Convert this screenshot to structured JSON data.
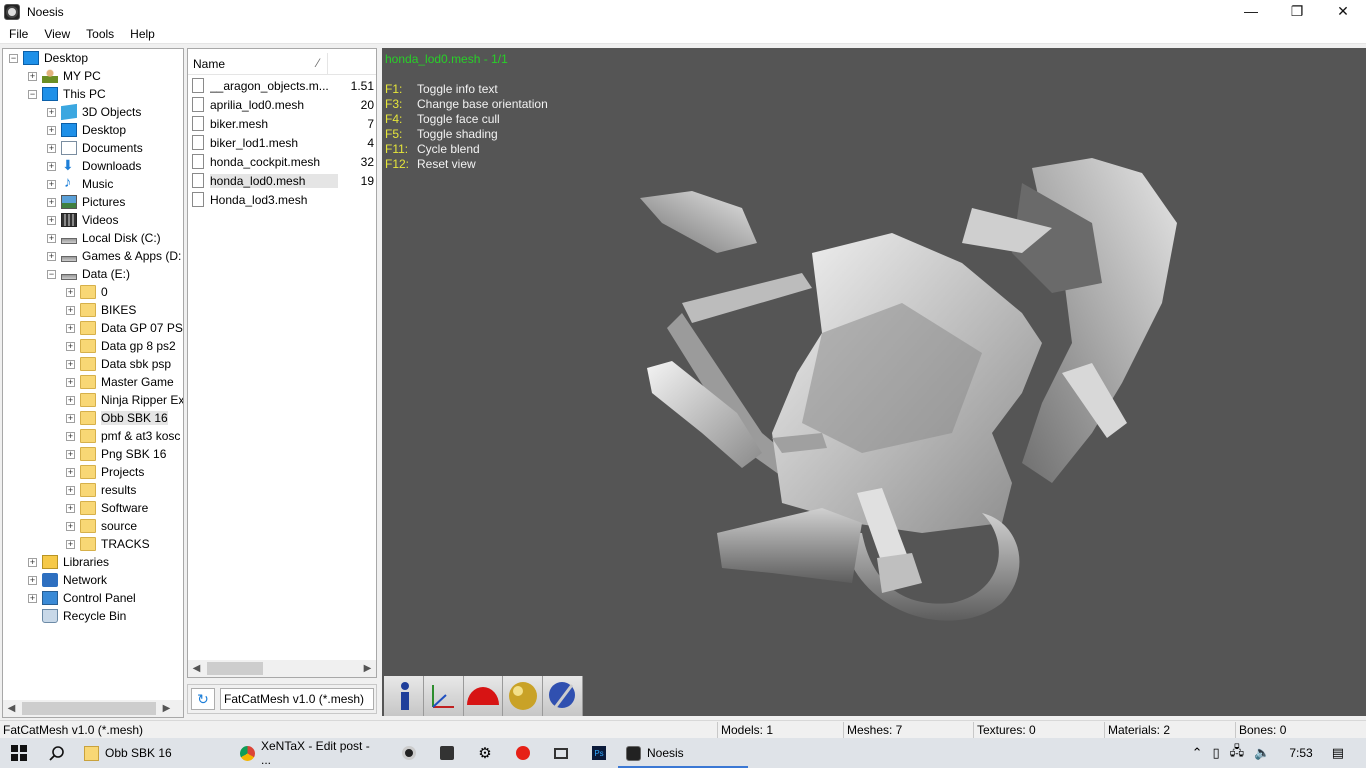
{
  "window": {
    "title": "Noesis",
    "minimize": "—",
    "restore": "❐",
    "close": "✕"
  },
  "menu": [
    "File",
    "View",
    "Tools",
    "Help"
  ],
  "tree": [
    {
      "label": "Desktop",
      "icon": "monitor-icon",
      "exp": "−"
    },
    {
      "label": "MY PC",
      "icon": "person-icon",
      "exp": "+"
    },
    {
      "label": "This PC",
      "icon": "monitor-icon",
      "exp": "−"
    },
    {
      "label": "3D Objects",
      "icon": "cube-icon",
      "exp": "+"
    },
    {
      "label": "Desktop",
      "icon": "monitor-icon",
      "exp": "+"
    },
    {
      "label": "Documents",
      "icon": "document-icon",
      "exp": "+"
    },
    {
      "label": "Downloads",
      "icon": "download-arrow-icon",
      "exp": "+"
    },
    {
      "label": "Music",
      "icon": "music-note-icon",
      "exp": "+"
    },
    {
      "label": "Pictures",
      "icon": "picture-icon",
      "exp": "+"
    },
    {
      "label": "Videos",
      "icon": "film-icon",
      "exp": "+"
    },
    {
      "label": "Local Disk (C:)",
      "icon": "disk-drive-icon",
      "exp": "+"
    },
    {
      "label": "Games & Apps (D:",
      "icon": "disk-drive-icon",
      "exp": "+"
    },
    {
      "label": "Data (E:)",
      "icon": "disk-drive-icon",
      "exp": "−"
    },
    {
      "label": "0",
      "icon": "folder-icon",
      "exp": "+"
    },
    {
      "label": "BIKES",
      "icon": "folder-icon",
      "exp": "+"
    },
    {
      "label": "Data GP 07 PS2",
      "icon": "folder-icon",
      "exp": "+"
    },
    {
      "label": "Data gp 8 ps2",
      "icon": "folder-icon",
      "exp": "+"
    },
    {
      "label": "Data sbk psp",
      "icon": "folder-icon",
      "exp": "+"
    },
    {
      "label": "Master Game",
      "icon": "folder-icon",
      "exp": "+"
    },
    {
      "label": "Ninja Ripper Ex",
      "icon": "folder-icon",
      "exp": "+"
    },
    {
      "label": "Obb SBK 16",
      "icon": "folder-icon",
      "exp": "+"
    },
    {
      "label": "pmf & at3 kosc",
      "icon": "folder-icon",
      "exp": "+"
    },
    {
      "label": "Png SBK 16",
      "icon": "folder-icon",
      "exp": "+"
    },
    {
      "label": "Projects",
      "icon": "folder-icon",
      "exp": "+"
    },
    {
      "label": "results",
      "icon": "folder-icon",
      "exp": "+"
    },
    {
      "label": "Software",
      "icon": "folder-icon",
      "exp": "+"
    },
    {
      "label": "source",
      "icon": "folder-icon",
      "exp": "+"
    },
    {
      "label": "TRACKS",
      "icon": "folder-icon",
      "exp": "+"
    },
    {
      "label": "Libraries",
      "icon": "library-icon",
      "exp": "+"
    },
    {
      "label": "Network",
      "icon": "network-icon",
      "exp": "+"
    },
    {
      "label": "Control Panel",
      "icon": "control-panel-icon",
      "exp": "+"
    },
    {
      "label": "Recycle Bin",
      "icon": "recycle-bin-icon",
      "exp": ""
    }
  ],
  "file_list": {
    "header_name": "Name",
    "sort_indicator": "⁄",
    "files": [
      {
        "name": "__aragon_objects.m...",
        "size": "1.51"
      },
      {
        "name": "aprilia_lod0.mesh",
        "size": "20"
      },
      {
        "name": "biker.mesh",
        "size": "7"
      },
      {
        "name": "biker_lod1.mesh",
        "size": "4"
      },
      {
        "name": "honda_cockpit.mesh",
        "size": "32"
      },
      {
        "name": "honda_lod0.mesh",
        "size": "19"
      },
      {
        "name": "Honda_lod3.mesh",
        "size": ""
      }
    ]
  },
  "format": {
    "refresh": "↻",
    "label": "FatCatMesh v1.0 (*.mesh)"
  },
  "viewport": {
    "title": "honda_lod0.mesh - 1/1",
    "help": [
      {
        "key": "F1:",
        "desc": "Toggle info text"
      },
      {
        "key": "F3:",
        "desc": "Change base orientation"
      },
      {
        "key": "F4:",
        "desc": "Toggle face cull"
      },
      {
        "key": "F5:",
        "desc": "Toggle shading"
      },
      {
        "key": "F11:",
        "desc": "Cycle blend"
      },
      {
        "key": "F12:",
        "desc": "Reset view"
      }
    ]
  },
  "status": {
    "format": "FatCatMesh v1.0 (*.mesh)",
    "models": "Models: 1",
    "meshes": "Meshes: 7",
    "textures": "Textures: 0",
    "materials": "Materials: 2",
    "bones": "Bones: 0"
  },
  "taskbar": {
    "tasks": [
      {
        "label": "Obb SBK 16",
        "icon": "folder-icon"
      },
      {
        "label": "XeNTaX - Edit post - ...",
        "icon": "chrome-icon"
      },
      {
        "label": "Noesis",
        "icon": "noesis-icon"
      }
    ],
    "clock": "7:53"
  }
}
